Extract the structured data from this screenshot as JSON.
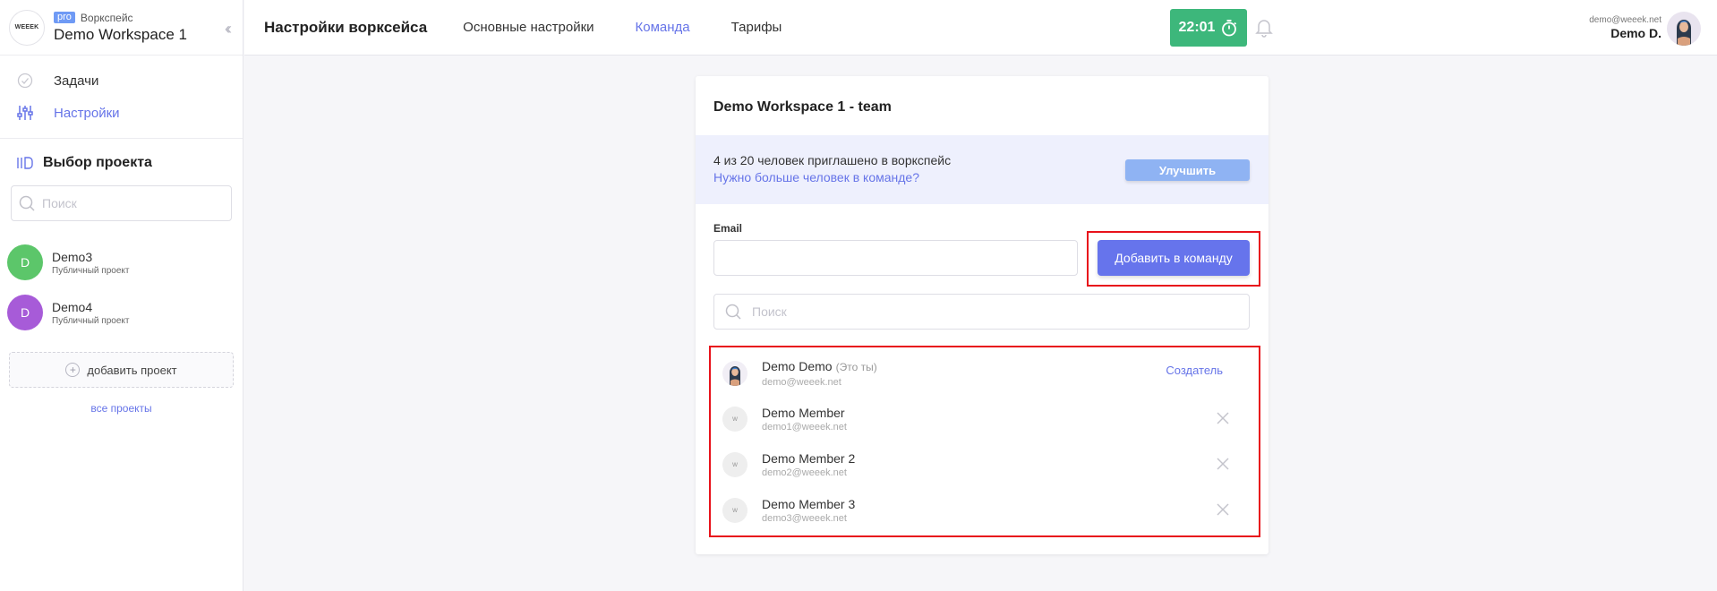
{
  "workspace": {
    "logo_text": "WEEEK",
    "badge": "pro",
    "label": "Воркспейс",
    "name": "Demo Workspace 1"
  },
  "nav": {
    "items": [
      {
        "label": "Задачи",
        "icon": "tasks-check-icon"
      },
      {
        "label": "Настройки",
        "icon": "sliders-icon",
        "active": true
      }
    ]
  },
  "projects": {
    "title": "Выбор проекта",
    "search_placeholder": "Поиск",
    "items": [
      {
        "name": "Demo3",
        "subtitle": "Публичный проект",
        "initial": "D",
        "color": "#5cc66a"
      },
      {
        "name": "Demo4",
        "subtitle": "Публичный проект",
        "initial": "D",
        "color": "#a75bd8"
      }
    ],
    "add_label": "добавить проект",
    "all_label": "все проекты"
  },
  "topbar": {
    "title": "Настройки ворксейса",
    "tabs": [
      {
        "label": "Основные настройки",
        "active": false
      },
      {
        "label": "Команда",
        "active": true
      },
      {
        "label": "Тарифы",
        "active": false
      }
    ],
    "timer": "22:01",
    "user_email": "demo@weeek.net",
    "user_name": "Demo D."
  },
  "team": {
    "title": "Demo Workspace 1 - team",
    "invite_text": "4 из 20 человек приглашено в воркспейс",
    "invite_link": "Нужно больше человек в команде?",
    "upgrade_label": "Улучшить",
    "email_label": "Email",
    "email_value": "",
    "add_button": "Добавить в команду",
    "search_placeholder": "Поиск",
    "members": [
      {
        "name": "Demo Demo",
        "you": "(Это ты)",
        "email": "demo@weeek.net",
        "role": "Создатель",
        "avatar": "photo"
      },
      {
        "name": "Demo Member",
        "email": "demo1@weeek.net",
        "avatar": "w"
      },
      {
        "name": "Demo Member 2",
        "email": "demo2@weeek.net",
        "avatar": "w"
      },
      {
        "name": "Demo Member 3",
        "email": "demo3@weeek.net",
        "avatar": "w"
      }
    ]
  },
  "colors": {
    "accent": "#6674e8",
    "timer": "#3db77b",
    "highlight": "#e8121b",
    "invite_bg": "#eef0fd"
  }
}
